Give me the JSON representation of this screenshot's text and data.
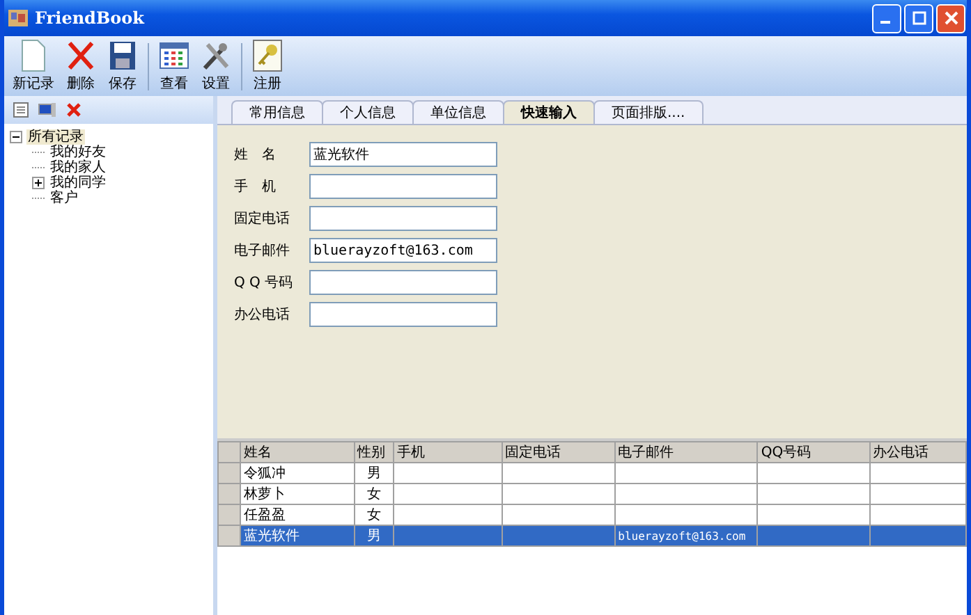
{
  "window": {
    "title": "FriendBook"
  },
  "toolbar": [
    {
      "kind": "new",
      "label": "新记录"
    },
    {
      "kind": "delete",
      "label": "删除"
    },
    {
      "kind": "save",
      "label": "保存"
    },
    {
      "kind": "view",
      "label": "查看"
    },
    {
      "kind": "settings",
      "label": "设置"
    },
    {
      "kind": "register",
      "label": "注册"
    }
  ],
  "sidebar": {
    "tools": [
      {
        "kind": "note"
      },
      {
        "kind": "computer"
      },
      {
        "kind": "delete"
      }
    ],
    "tree": [
      {
        "label": "所有记录",
        "expanded": true,
        "selected": true,
        "children": [
          {
            "label": "我的好友",
            "selected": false
          },
          {
            "label": "我的家人",
            "selected": false
          },
          {
            "label": "我的同学",
            "expanded": false,
            "selected": false
          },
          {
            "label": "客户",
            "selected": false
          }
        ]
      }
    ]
  },
  "tabs": [
    {
      "label": "常用信息",
      "selected": false
    },
    {
      "label": "个人信息",
      "selected": false
    },
    {
      "label": "单位信息",
      "selected": false
    },
    {
      "label": "快速输入",
      "selected": true
    },
    {
      "label": "页面排版....",
      "selected": false
    }
  ],
  "form": [
    {
      "label": "姓　名",
      "value": "蓝光软件"
    },
    {
      "label": "手　机"
    },
    {
      "label": "固定电话"
    },
    {
      "label": "电子邮件",
      "value": "bluerayzoft@163.com"
    },
    {
      "label": "Q Q 号码"
    },
    {
      "label": "办公电话"
    }
  ],
  "table": {
    "columns": [
      "姓名",
      "性别",
      "手机",
      "固定电话",
      "电子邮件",
      "QQ号码",
      "办公电话"
    ],
    "rows": [
      {
        "cells": [
          "令狐冲",
          "男",
          "",
          "",
          "",
          "",
          ""
        ],
        "selected": false
      },
      {
        "cells": [
          "林萝卜",
          "女",
          "",
          "",
          "",
          "",
          ""
        ],
        "selected": false
      },
      {
        "cells": [
          "任盈盈",
          "女",
          "",
          "",
          "",
          "",
          ""
        ],
        "selected": false
      },
      {
        "cells": [
          "蓝光软件",
          "男",
          "",
          "",
          "bluerayzoft@163.com",
          "",
          ""
        ],
        "selected": true
      }
    ]
  }
}
